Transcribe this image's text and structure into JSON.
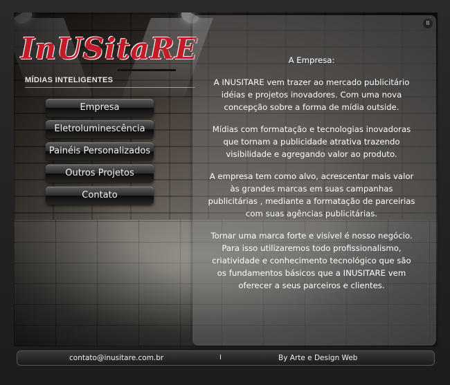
{
  "logo": {
    "brand": "InUSitaRE",
    "tagline": "MÍDIAS INTELIGENTES"
  },
  "menu": {
    "items": [
      {
        "label": "Empresa"
      },
      {
        "label": "Eletroluminescência"
      },
      {
        "label": "Painéis Personalizados"
      },
      {
        "label": "Outros Projetos"
      },
      {
        "label": "Contato"
      }
    ]
  },
  "content": {
    "title": "A Empresa:",
    "paragraphs": [
      "A INUSITARE vem trazer ao mercado publicitário idéias e projetos inovadores. Com uma nova concepção sobre a forma de mídia outside.",
      "Mídias com formatação e tecnologias inovadoras que tornam a publicidade atrativa trazendo visibilidade e agregando valor ao produto.",
      "A empresa tem como alvo, acrescentar mais valor às grandes marcas em suas campanhas publicitárias , mediante a formatação de parceirias com suas agências publicitárias.",
      "Tornar uma marca forte e visível é nosso negócio. Para isso utilizaremos todo profissionalismo, criatividade e conhecimento tecnológico que são os fundamentos básicos que a INUSITARE vem oferecer a seus parceiros e clientes."
    ],
    "close_icon": "pause-icon"
  },
  "footer": {
    "email": "contato@inusitare.com.br",
    "separator": "I",
    "credit": "By Arte e Design Web"
  },
  "colors": {
    "brand_red": "#c41b2a",
    "panel": "#787878",
    "text": "#ffffff"
  }
}
